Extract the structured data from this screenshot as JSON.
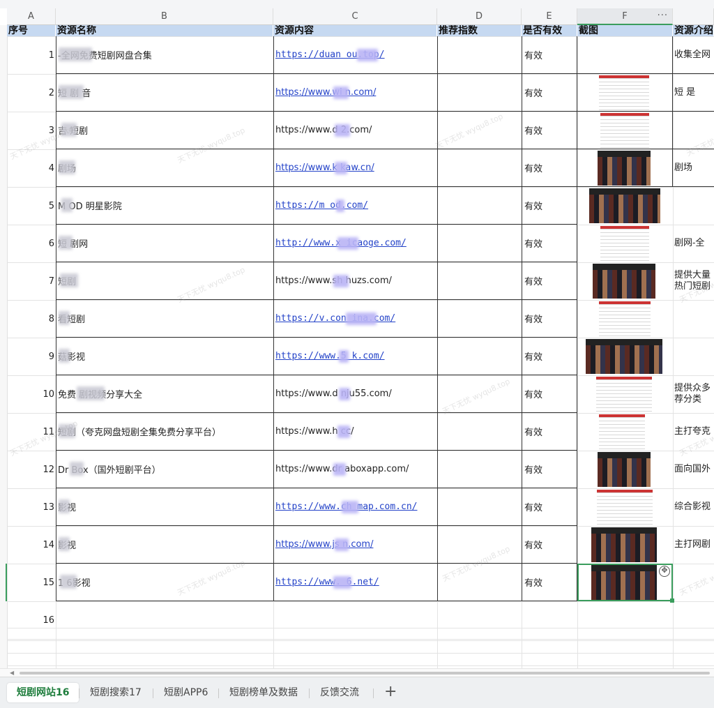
{
  "columns": [
    "A",
    "B",
    "C",
    "D",
    "E",
    "F"
  ],
  "column_more": "···",
  "headers": {
    "index": "序号",
    "name": "资源名称",
    "content": "资源内容",
    "rating": "推荐指数",
    "valid": "是否有效",
    "screenshot": "截图",
    "intro": "资源介绍"
  },
  "rows": [
    {
      "num": "1",
      "name": "-全网免费短剧网盘合集",
      "url": "https://duan  ou.top/",
      "url_style": "mono",
      "valid": "有效",
      "intro": "收集全网"
    },
    {
      "num": "2",
      "name": "短 剧 音",
      "url": "https://www.wi  n.com/",
      "url_style": "sans",
      "valid": "有效",
      "intro": "短 是"
    },
    {
      "num": "3",
      "name": "吉  短剧",
      "url": "https://www.d  2.com/",
      "url_style": "plain",
      "valid": "有效",
      "intro": ""
    },
    {
      "num": "4",
      "name": "  剧场",
      "url": "https://www.k  kaw.cn/",
      "url_style": "sans",
      "valid": "有效",
      "intro": "剧场"
    },
    {
      "num": "5",
      "name": "M OD 明星影院",
      "url": "https://m od.com/",
      "url_style": "mono",
      "valid": "有效",
      "intro": ""
    },
    {
      "num": "6",
      "name": "短 剧网",
      "url": "http://www.x  icaoge.com/",
      "url_style": "mono",
      "valid": "有效",
      "intro": "剧网-全"
    },
    {
      "num": "7",
      "name": "  短剧",
      "url": "https://www.sh  huzs.com/",
      "url_style": "plain",
      "valid": "有效",
      "intro": "提供大量\n热门短剧"
    },
    {
      "num": "8",
      "name": "  看短剧",
      "url": "https://v.con  ina.com/",
      "url_style": "mono",
      "valid": "有效",
      "intro": ""
    },
    {
      "num": "9",
      "name": " 菇影视",
      "url": "https://www.5  k.com/",
      "url_style": "mono",
      "valid": "有效",
      "intro": ""
    },
    {
      "num": "10",
      "name": "免费  剧视频分享大全",
      "url": "https://www.d  nju55.com/",
      "url_style": "plain",
      "valid": "有效",
      "intro": "提供众多\n荐分类"
    },
    {
      "num": "11",
      "name": "  短剧（夸克网盘短剧全集免费分享平台）",
      "url": "https://www.h  cc/",
      "url_style": "plain",
      "valid": "有效",
      "intro": "主打夸克"
    },
    {
      "num": "12",
      "name": "Dr  Box（国外短剧平台）",
      "url": "https://www.dr  aboxapp.com/",
      "url_style": "plain",
      "valid": "有效",
      "intro": "面向国外"
    },
    {
      "num": "13",
      "name": "  影视",
      "url": "https://www.ch  map.com.cn/",
      "url_style": "mono",
      "valid": "有效",
      "intro": "综合影视"
    },
    {
      "num": "14",
      "name": "  影视",
      "url": "https://www.js  n.com/",
      "url_style": "sans",
      "valid": "有效",
      "intro": "主打网剧"
    },
    {
      "num": "15",
      "name": "1  6影视",
      "url": "https://www.  6.net/",
      "url_style": "mono",
      "valid": "有效",
      "intro": ""
    }
  ],
  "extra_row": "16",
  "tabs": [
    "短剧网站16",
    "短剧搜索17",
    "短剧APP6",
    "短剧榜单及数据",
    "反馈交流"
  ],
  "tab_add": "+",
  "watermark": "天下无忧 wyqu8.top"
}
